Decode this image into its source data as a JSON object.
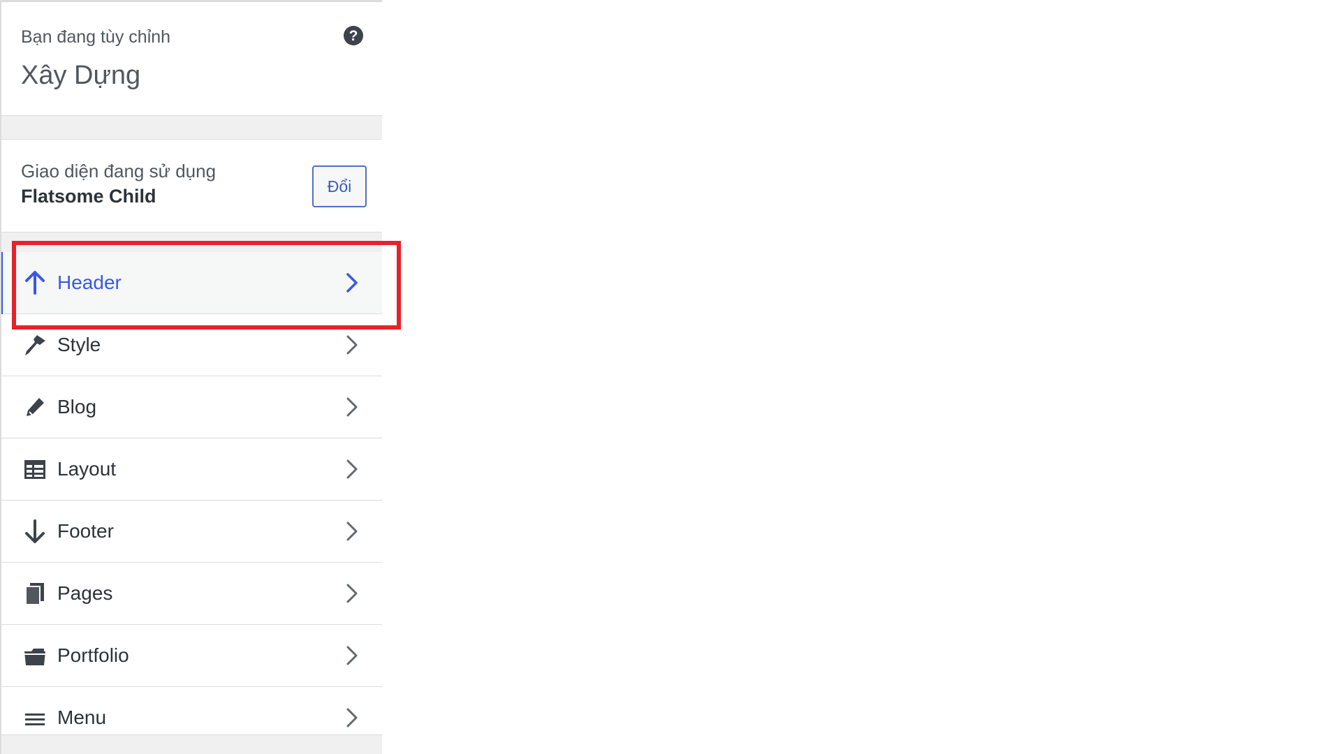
{
  "info": {
    "pre_title": "Bạn đang tùy chỉnh",
    "site_title": "Xây Dựng",
    "help_symbol": "?"
  },
  "theme": {
    "label": "Giao diện đang sử dụng",
    "name": "Flatsome Child",
    "change_button": "Đổi"
  },
  "menu": {
    "items": [
      {
        "label": "Header",
        "icon": "arrow-up-icon",
        "active": true
      },
      {
        "label": "Style",
        "icon": "paintbrush-icon",
        "active": false
      },
      {
        "label": "Blog",
        "icon": "pencil-icon",
        "active": false
      },
      {
        "label": "Layout",
        "icon": "layout-table-icon",
        "active": false
      },
      {
        "label": "Footer",
        "icon": "arrow-down-icon",
        "active": false
      },
      {
        "label": "Pages",
        "icon": "pages-icon",
        "active": false
      },
      {
        "label": "Portfolio",
        "icon": "portfolio-icon",
        "active": false
      },
      {
        "label": "Menu",
        "icon": "menu-lines-icon",
        "active": false
      }
    ]
  },
  "colors": {
    "accent": "#3858e9",
    "highlight_box": "#e8212a",
    "panel_bg": "#f0f0f1"
  }
}
